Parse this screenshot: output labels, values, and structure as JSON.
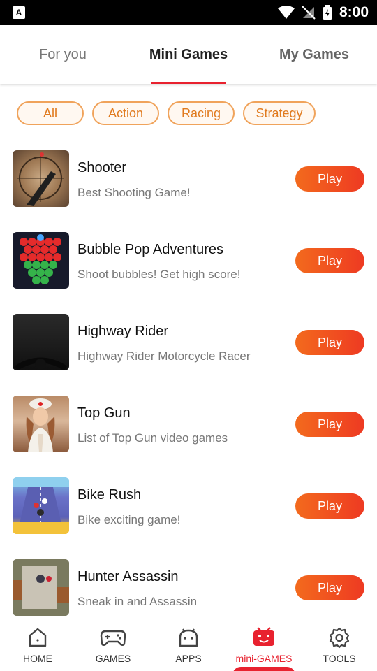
{
  "status_bar": {
    "time": "8:00",
    "app_badge": "A"
  },
  "top_tabs": [
    {
      "label": "For you",
      "active": false
    },
    {
      "label": "Mini Games",
      "active": true
    },
    {
      "label": "My Games",
      "active": false
    }
  ],
  "filters": [
    {
      "label": "All"
    },
    {
      "label": "Action"
    },
    {
      "label": "Racing"
    },
    {
      "label": "Strategy"
    }
  ],
  "games": [
    {
      "title": "Shooter",
      "description": "Best Shooting Game!",
      "button": "Play",
      "thumb": "shooter-thumbnail"
    },
    {
      "title": "Bubble Pop Adventures",
      "description": "Shoot bubbles! Get high score!",
      "button": "Play",
      "thumb": "bubble-thumbnail"
    },
    {
      "title": "Highway Rider",
      "description": "Highway Rider Motorcycle Racer",
      "button": "Play",
      "thumb": "highway-thumbnail"
    },
    {
      "title": "Top Gun",
      "description": "List of Top Gun video games",
      "button": "Play",
      "thumb": "topgun-thumbnail"
    },
    {
      "title": "Bike Rush",
      "description": "Bike exciting game!",
      "button": "Play",
      "thumb": "bike-thumbnail"
    },
    {
      "title": "Hunter Assassin",
      "description": "Sneak in and Assassin",
      "button": "Play",
      "thumb": "hunter-thumbnail"
    }
  ],
  "bottom_nav": [
    {
      "label": "HOME",
      "icon": "home-icon",
      "active": false
    },
    {
      "label": "GAMES",
      "icon": "gamepad-icon",
      "active": false
    },
    {
      "label": "APPS",
      "icon": "android-icon",
      "active": false
    },
    {
      "label": "mini-GAMES",
      "icon": "mini-games-icon",
      "active": true
    },
    {
      "label": "TOOLS",
      "icon": "gear-icon",
      "active": false
    }
  ],
  "colors": {
    "accent": "#e8222f",
    "play_gradient_start": "#f36a1d",
    "play_gradient_end": "#ee3a22",
    "chip_border": "#f0a35b",
    "chip_text": "#e07a1e"
  }
}
